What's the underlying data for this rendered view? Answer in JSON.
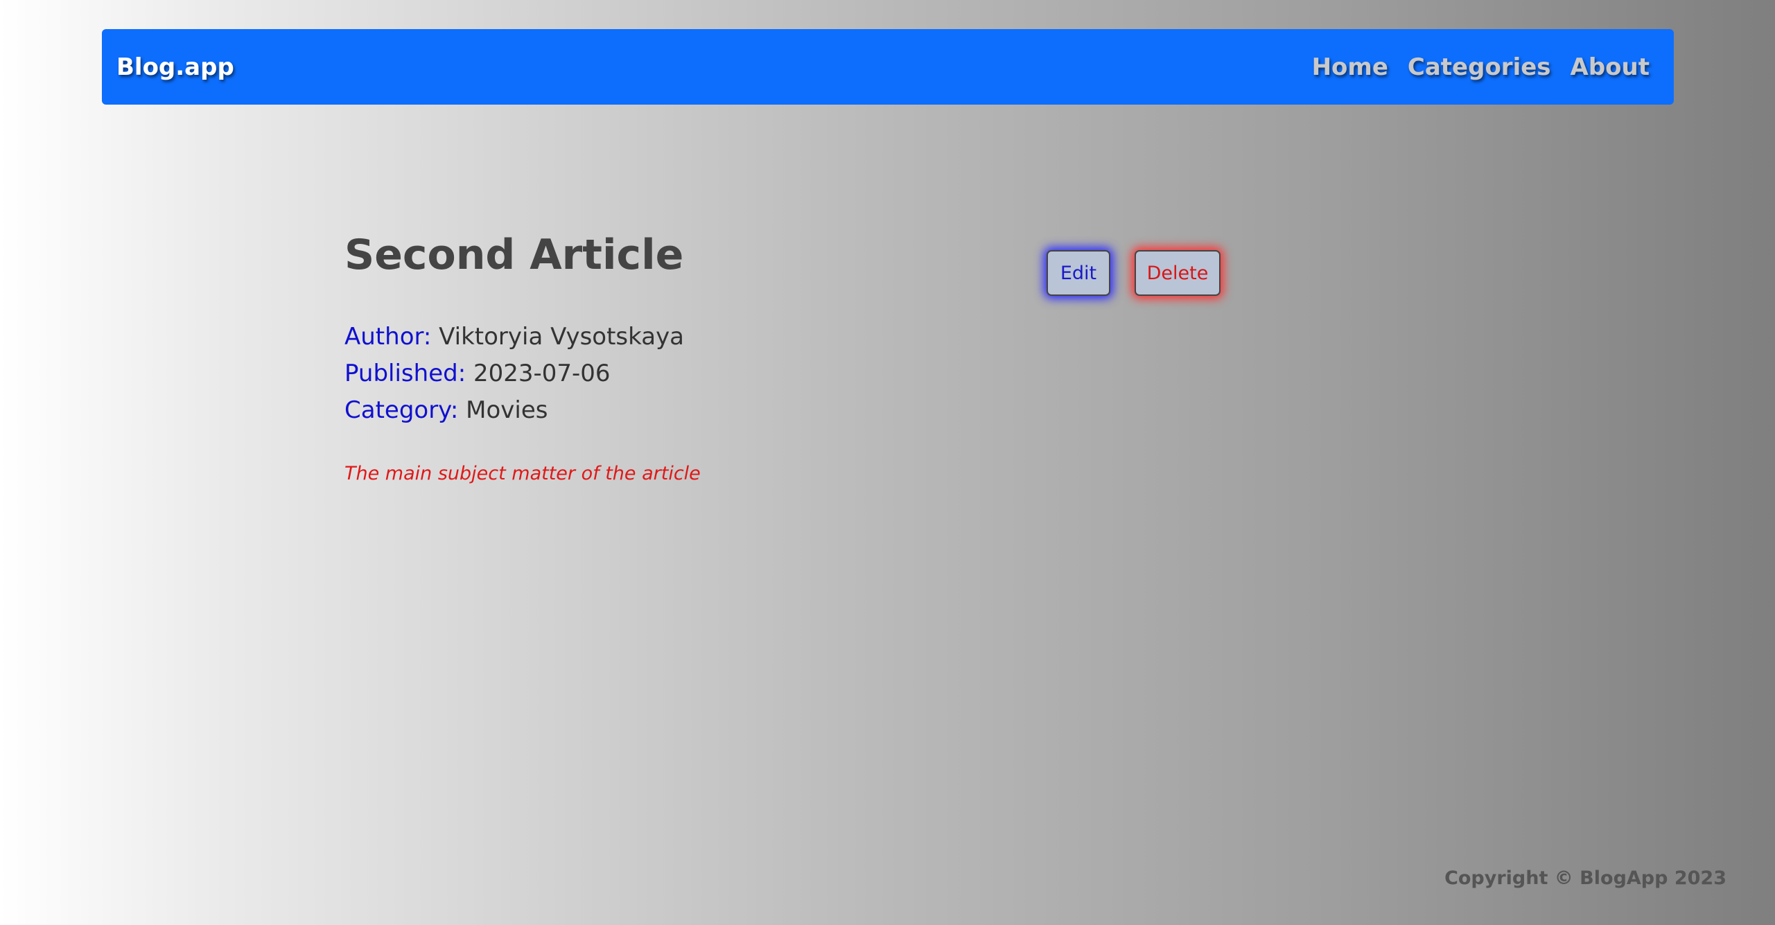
{
  "navbar": {
    "brand": "Blog.app",
    "links": [
      "Home",
      "Categories",
      "About"
    ],
    "background_color": "#0d6efd"
  },
  "article": {
    "title": "Second Article",
    "meta": [
      {
        "label": "Author:",
        "value": "Viktoryia Vysotskaya"
      },
      {
        "label": "Published:",
        "value": "2023-07-06"
      },
      {
        "label": "Category:",
        "value": "Movies"
      }
    ],
    "subject": "The main subject matter of the article"
  },
  "actions": {
    "edit_label": "Edit",
    "delete_label": "Delete"
  },
  "footer": {
    "copyright": "Copyright © BlogApp 2023"
  }
}
